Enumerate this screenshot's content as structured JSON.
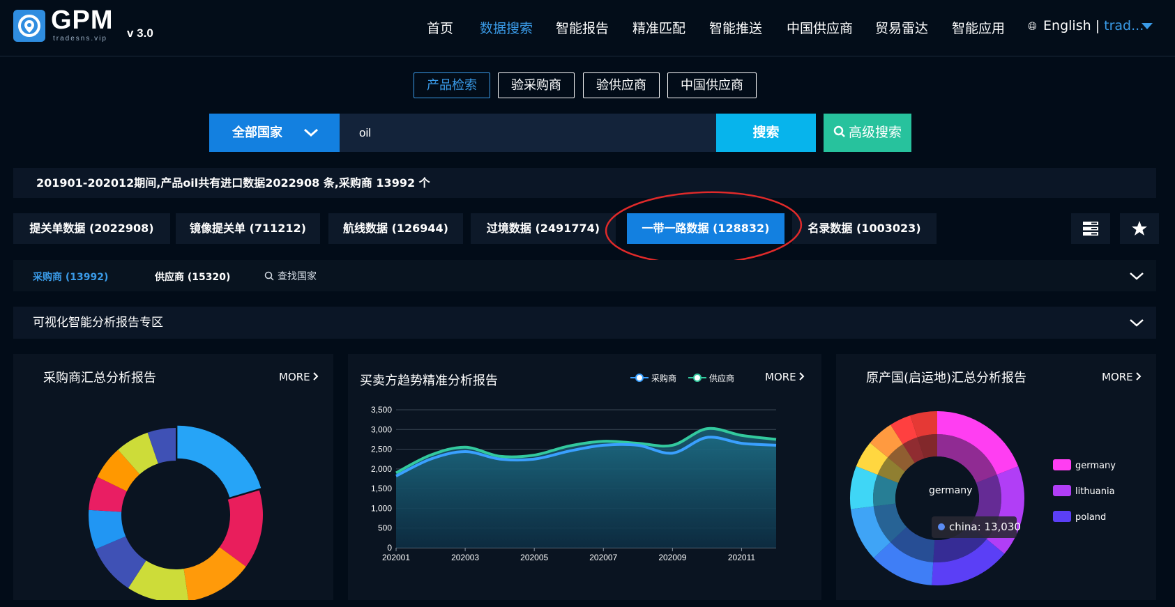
{
  "header": {
    "logo_text": "GPM",
    "logo_sub": "tradesns.vip",
    "version": "v 3.0",
    "nav": [
      "首页",
      "数据搜索",
      "智能报告",
      "精准匹配",
      "智能推送",
      "中国供应商",
      "贸易雷达",
      "智能应用"
    ],
    "active_nav": "数据搜索",
    "language": "English",
    "separator": "|",
    "user": "trad..."
  },
  "search_tabs": [
    "产品检索",
    "验采购商",
    "验供应商",
    "中国供应商"
  ],
  "search": {
    "country": "全部国家",
    "query": "oil",
    "search_label": "搜索",
    "advanced_label": "高级搜索"
  },
  "summary": "201901-202012期间,产品oil共有进口数据2022908 条,采购商 13992 个",
  "data_tabs": [
    "提关单数据 (2022908)",
    "镜像提关单 (711212)",
    "航线数据 (126944)",
    "过境数据 (2491774)",
    "一带一路数据 (128832)",
    "名录数据 (1003023)"
  ],
  "active_data_tab": "一带一路数据 (128832)",
  "filters": {
    "buyers": "采购商 (13992)",
    "suppliers": "供应商 (15320)",
    "search_country": "查找国家"
  },
  "report_zone": "可视化智能分析报告专区",
  "panels": {
    "buyer_report": {
      "title": "采购商汇总分析报告",
      "more": "MORE"
    },
    "trend_report": {
      "title": "买卖方趋势精准分析报告",
      "more": "MORE",
      "legend_buyer": "采购商",
      "legend_supplier": "供应商"
    },
    "origin_report": {
      "title": "原产国(启运地)汇总分析报告",
      "more": "MORE",
      "center_text": "germany",
      "tooltip_name": "china",
      "tooltip_value": "13,030"
    }
  },
  "colors": {
    "accent": "#1380e0",
    "search_btn": "#07b4ec",
    "advanced_btn": "#27c29d",
    "ellipse": "#e02a2a"
  },
  "chart_data": [
    {
      "type": "pie",
      "variant": "donut",
      "slice_colors": [
        "#26a4f7",
        "#e91e5c",
        "#ff9a0a",
        "#cddc39",
        "#3f51b5",
        "#2196f3",
        "#e91e63",
        "#ff9800",
        "#cddc39",
        "#3f51b5"
      ],
      "values": [
        19.5,
        14,
        12,
        11,
        9,
        7,
        6,
        6,
        6,
        5
      ]
    },
    {
      "type": "area",
      "x": [
        "202001",
        "202002",
        "202003",
        "202004",
        "202005",
        "202006",
        "202007",
        "202008",
        "202009",
        "202010",
        "202011",
        "202012"
      ],
      "x_tick_labels": [
        "202001",
        "202003",
        "202005",
        "202007",
        "202009",
        "202011"
      ],
      "ylim": [
        0,
        3500
      ],
      "y_ticks": [
        "0",
        "500",
        "1,000",
        "1,500",
        "2,000",
        "2,500",
        "3,000",
        "3,500"
      ],
      "series": [
        {
          "name": "采购商",
          "values": [
            1820,
            2250,
            2440,
            2250,
            2250,
            2450,
            2600,
            2600,
            2400,
            2800,
            2650,
            2600
          ]
        },
        {
          "name": "供应商",
          "values": [
            1900,
            2350,
            2550,
            2320,
            2350,
            2580,
            2700,
            2650,
            2600,
            3020,
            2850,
            2750
          ]
        }
      ]
    },
    {
      "type": "pie",
      "variant": "nested-donut",
      "legend": [
        "germany",
        "lithuania",
        "poland"
      ],
      "legend_colors": [
        "#ff3ef2",
        "#b13ef6",
        "#5b3ff6"
      ],
      "slice_colors": [
        "#ff3ef2",
        "#b13ef6",
        "#5b3ff6",
        "#3f7ef6",
        "#3fa4f6",
        "#3fd6f6",
        "#ffd740",
        "#ff9a40",
        "#ff4040",
        "#e53935"
      ],
      "values": [
        19,
        17,
        15,
        12,
        10,
        8,
        5,
        5,
        4,
        5
      ]
    }
  ]
}
